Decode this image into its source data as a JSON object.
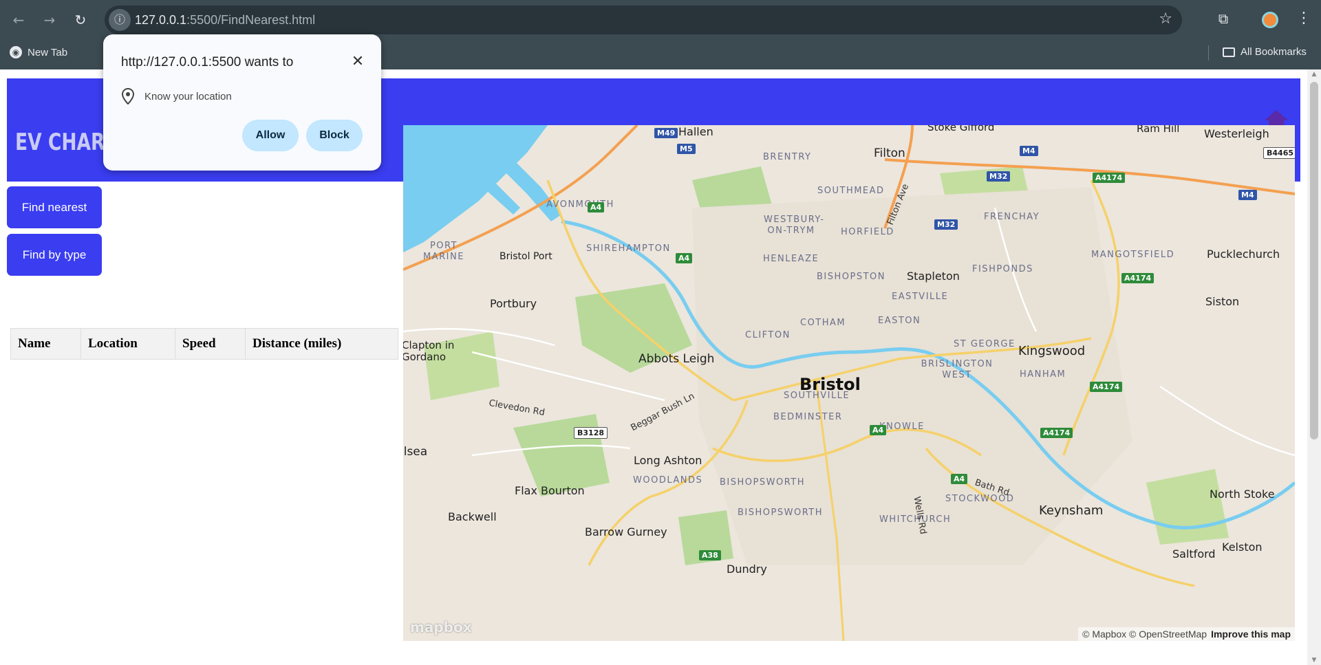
{
  "browser": {
    "url_host": "127.0.0.1",
    "url_path": ":5500/FindNearest.html",
    "bookmarks": {
      "new_tab": "New Tab",
      "all_bookmarks": "All Bookmarks"
    },
    "icons": {
      "back": "back-arrow-icon",
      "forward": "forward-arrow-icon",
      "reload": "reload-icon",
      "site_info": "info-icon",
      "star": "star-icon",
      "extensions": "puzzle-icon",
      "menu": "kebab-menu-icon"
    }
  },
  "permission_popup": {
    "title": "http://127.0.0.1:5500 wants to",
    "permission": "Know your location",
    "allow_label": "Allow",
    "block_label": "Block"
  },
  "page": {
    "header_title": "EV CHARGI",
    "header_color": "#3a3df0",
    "buttons": {
      "find_nearest": "Find nearest",
      "find_by_type": "Find by type"
    },
    "table": {
      "headers": [
        "Name",
        "Location",
        "Speed",
        "Distance (miles)"
      ]
    }
  },
  "map": {
    "city": "Bristol",
    "towns": [
      "Hallen",
      "Stoke Gifford",
      "Ram Hill",
      "Westerleigh",
      "Filton",
      "Bristol Port",
      "Portbury",
      "Stapleton",
      "Pucklechurch",
      "Siston",
      "Clapton in Gordano",
      "Abbots Leigh",
      "Kingswood",
      "Long Ashton",
      "Flax Bourton",
      "Backwell",
      "Barrow Gurney",
      "Dundry",
      "Keynsham",
      "North Stoke",
      "Kelston",
      "Saltford",
      "ilsea"
    ],
    "areas": [
      "BRENTRY",
      "SOUTHMEAD",
      "AVONMOUTH",
      "PORT MARINE",
      "WESTBURY-ON-TRYM",
      "HORFIELD",
      "FRENCHAY",
      "SHIREHAMPTON",
      "HENLEAZE",
      "BISHOPSTON",
      "FISHPONDS",
      "MANGOTSFIELD",
      "EASTVILLE",
      "COTHAM",
      "EASTON",
      "CLIFTON",
      "ST GEORGE",
      "BRISLINGTON WEST",
      "HANHAM",
      "SOUTHVILLE",
      "BEDMINSTER",
      "KNOWLE",
      "WOODLANDS",
      "BISHOPSWORTH",
      "STOCKWOOD",
      "WHITCHURCH"
    ],
    "roads": [
      "M49",
      "M5",
      "M4",
      "M32",
      "A4174",
      "B4465",
      "A4",
      "A38",
      "B3128",
      "Clevedon Rd",
      "Beggar Bush Ln",
      "Filton Ave",
      "Bath Rd",
      "Wells Rd"
    ],
    "logo": "mapbox",
    "attribution": "© Mapbox © OpenStreetMap",
    "improve": "Improve this map"
  }
}
